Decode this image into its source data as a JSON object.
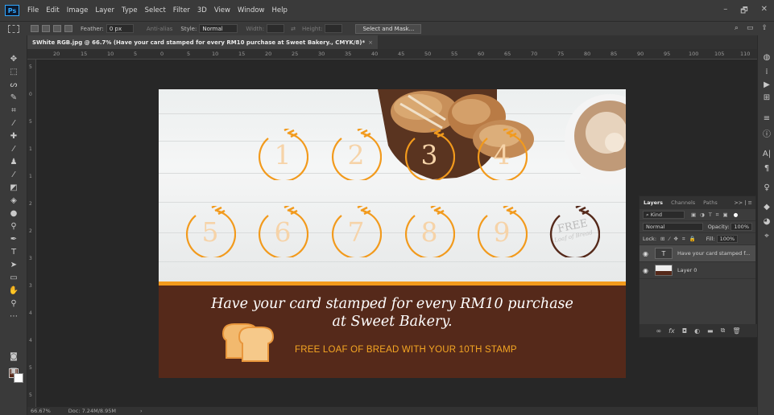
{
  "app": {
    "logo": "Ps",
    "window_controls": [
      "–",
      "🗗",
      "✕"
    ]
  },
  "menu": [
    "File",
    "Edit",
    "Image",
    "Layer",
    "Type",
    "Select",
    "Filter",
    "3D",
    "View",
    "Window",
    "Help"
  ],
  "options": {
    "feather_label": "Feather:",
    "feather_value": "0 px",
    "antialias_label": "Anti-alias",
    "style_label": "Style:",
    "style_value": "Normal",
    "width_label": "Width:",
    "height_label": "Height:",
    "select_mask": "Select and Mask..."
  },
  "document_tab": {
    "title": "SWhite RGB.jpg @ 66.7% (Have your card stamped for every RM10 purchase at Sweet Bakery., CMYK/8)*",
    "close": "×"
  },
  "ruler_h_ticks": [
    "20",
    "15",
    "10",
    "5",
    "0",
    "5",
    "10",
    "15",
    "20",
    "25",
    "30",
    "35",
    "40",
    "45",
    "50",
    "55",
    "60",
    "65",
    "70",
    "75",
    "80",
    "85",
    "90",
    "95",
    "100",
    "105",
    "110"
  ],
  "ruler_v_ticks": [
    "5",
    "0",
    "5",
    "1",
    "1",
    "2",
    "2",
    "3",
    "3",
    "4",
    "4",
    "5",
    "5"
  ],
  "status": {
    "zoom": "66.67%",
    "doc": "Doc: 7.24M/8.95M",
    "arrow": "›"
  },
  "card": {
    "stamps": [
      "1",
      "2",
      "3",
      "4",
      "5",
      "6",
      "7",
      "8",
      "9"
    ],
    "free_stamp_title": "FREE",
    "free_stamp_sub": "Loaf of Bread",
    "tagline_line1": "Have your card stamped for every RM10 purchase",
    "tagline_line2": "at Sweet Bakery.",
    "free_offer": "FREE LOAF OF BREAD WITH YOUR 10TH STAMP",
    "colors": {
      "orange": "#f29a1c",
      "brown": "#55291a",
      "number": "#f6d3a8"
    }
  },
  "layers_panel": {
    "tabs": [
      "Layers",
      "Channels",
      "Paths"
    ],
    "more": ">> | ≡",
    "kind": "Kind",
    "blend_mode": "Normal",
    "opacity_label": "Opacity:",
    "opacity_value": "100%",
    "lock_label": "Lock:",
    "fill_label": "Fill:",
    "fill_value": "100%",
    "layers": [
      {
        "name": "Have your card stamped f...",
        "thumb": "T"
      },
      {
        "name": "Layer 0",
        "thumb": ""
      }
    ],
    "footer_icons": [
      "link-icon",
      "fx-icon",
      "mask-icon",
      "adjustment-icon",
      "folder-icon",
      "new-layer-icon",
      "trash-icon"
    ]
  }
}
